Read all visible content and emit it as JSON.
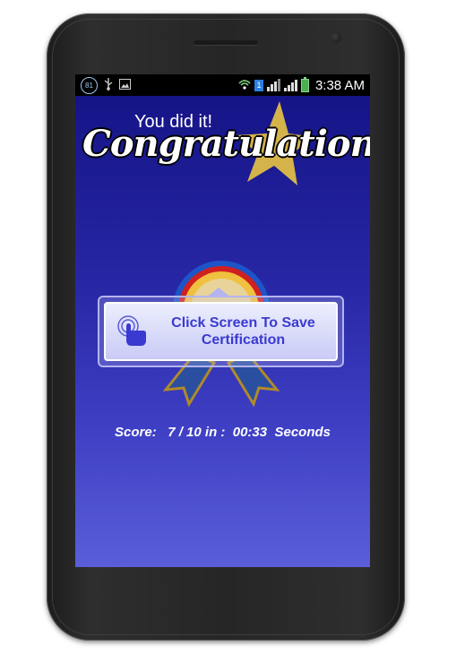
{
  "status_bar": {
    "notification_badge": "81",
    "sim_indicator": "1",
    "time": "3:38 AM",
    "icons": [
      "usb-icon",
      "image-icon",
      "wifi-icon",
      "signal-icon",
      "battery-charging-icon"
    ]
  },
  "header": {
    "subtitle": "You did it!",
    "title": "Congratulations"
  },
  "save_card": {
    "line1": "Click Screen To Save",
    "line2": "Certification"
  },
  "score": {
    "label": "Score:",
    "value": "7 / 10",
    "in_label": "in :",
    "time": "00:33",
    "unit": "Seconds"
  },
  "colors": {
    "background_top": "#151487",
    "background_bottom": "#5a5ed9",
    "star": "#d4b34a",
    "card_text": "#3a3ad0"
  }
}
